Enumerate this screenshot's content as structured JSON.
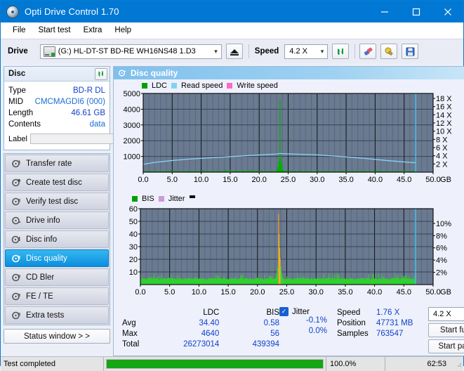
{
  "window": {
    "title": "Opti Drive Control 1.70",
    "icon": "disc-icon",
    "minimize": "minimize-icon",
    "maximize": "maximize-icon",
    "close": "close-icon"
  },
  "menu": [
    {
      "label": "File"
    },
    {
      "label": "Start test"
    },
    {
      "label": "Extra"
    },
    {
      "label": "Help"
    }
  ],
  "toolbar": {
    "drive_label": "Drive",
    "drive_value": "(G:)   HL-DT-ST BD-RE  WH16NS48 1.D3",
    "eject_icon": "eject-icon",
    "speed_label": "Speed",
    "speed_value": "4.2 X",
    "refresh_icon": "refresh-icon",
    "erase_icon": "eraser-icon",
    "bulb_icon": "bulb-icon",
    "save_icon": "save-icon"
  },
  "disc": {
    "header": "Disc",
    "refresh_icon": "refresh-icon",
    "fields": [
      {
        "key": "Type",
        "value": "BD-R DL",
        "link": false
      },
      {
        "key": "MID",
        "value": "CMCMAGDI6 (000)",
        "link": true
      },
      {
        "key": "Length",
        "value": "46.61 GB",
        "link": false
      },
      {
        "key": "Contents",
        "value": "data",
        "link": true
      }
    ],
    "label_key": "Label",
    "label_value": "",
    "label_placeholder": "",
    "disc_icon": "cd-icon"
  },
  "nav": {
    "items": [
      {
        "label": "Transfer rate",
        "icon": "transfer-icon",
        "active": false
      },
      {
        "label": "Create test disc",
        "icon": "create-disc-icon",
        "active": false
      },
      {
        "label": "Verify test disc",
        "icon": "verify-disc-icon",
        "active": false
      },
      {
        "label": "Drive info",
        "icon": "drive-info-icon",
        "active": false
      },
      {
        "label": "Disc info",
        "icon": "disc-info-icon",
        "active": false
      },
      {
        "label": "Disc quality",
        "icon": "disc-quality-icon",
        "active": true
      },
      {
        "label": "CD Bler",
        "icon": "cd-bler-icon",
        "active": false
      },
      {
        "label": "FE / TE",
        "icon": "fe-te-icon",
        "active": false
      },
      {
        "label": "Extra tests",
        "icon": "extra-tests-icon",
        "active": false
      }
    ],
    "status_window": "Status window > >"
  },
  "panel": {
    "title": "Disc quality",
    "icon": "disc-quality-icon"
  },
  "chart_data": [
    {
      "type": "area",
      "name": "ldc-chart",
      "title": "",
      "xlabel": "GB",
      "ylabel": "",
      "xlim": [
        0.0,
        50.0
      ],
      "ylim": [
        0,
        5000
      ],
      "y2lim": [
        0,
        18
      ],
      "grid": true,
      "legend": [
        {
          "label": "LDC",
          "color": "#00a000"
        },
        {
          "label": "Read speed",
          "color": "#80d8f0"
        },
        {
          "label": "Write speed",
          "color": "#ff66cc"
        }
      ],
      "xticks": [
        "0.0",
        "5.0",
        "10.0",
        "15.0",
        "20.0",
        "25.0",
        "30.0",
        "35.0",
        "40.0",
        "45.0",
        "50.0"
      ],
      "yticks": [
        "5000",
        "4000",
        "3000",
        "2000",
        "1000"
      ],
      "y2ticks": [
        "18 X",
        "16 X",
        "14 X",
        "12 X",
        "10 X",
        "8 X",
        "6 X",
        "4 X",
        "2 X"
      ],
      "series": [
        {
          "name": "LDC",
          "color": "#00b000",
          "kind": "bars",
          "x_end": 47.0,
          "baseline": 30,
          "spike": {
            "x": 23.6,
            "y": 4640
          },
          "noise_amp": 120
        },
        {
          "name": "Read speed",
          "color": "#8ad4f5",
          "kind": "line",
          "points": [
            [
              0.0,
              500
            ],
            [
              2.0,
              620
            ],
            [
              5.0,
              740
            ],
            [
              8.0,
              830
            ],
            [
              11.0,
              900
            ],
            [
              14.0,
              960
            ],
            [
              17.0,
              1030
            ],
            [
              20.0,
              1090
            ],
            [
              23.0,
              1150
            ],
            [
              23.6,
              1190
            ],
            [
              24.2,
              1170
            ],
            [
              26.0,
              1150
            ],
            [
              30.0,
              1100
            ],
            [
              34.0,
              1000
            ],
            [
              38.0,
              880
            ],
            [
              42.0,
              740
            ],
            [
              46.0,
              620
            ],
            [
              47.0,
              600
            ]
          ]
        },
        {
          "name": "Write speed",
          "color": "#ff66cc",
          "kind": "line",
          "points": []
        }
      ],
      "markers": [
        {
          "x": 47.0,
          "color": "#3bc8f5",
          "label": "position-marker"
        }
      ]
    },
    {
      "type": "area",
      "name": "bis-chart",
      "title": "",
      "xlabel": "GB",
      "ylabel": "",
      "xlim": [
        0.0,
        50.0
      ],
      "ylim": [
        0,
        60
      ],
      "y2lim": [
        0,
        10
      ],
      "grid": true,
      "legend": [
        {
          "label": "BIS",
          "color": "#00a000"
        },
        {
          "label": "Jitter",
          "color": "#cc9ad8"
        }
      ],
      "xticks": [
        "0.0",
        "5.0",
        "10.0",
        "15.0",
        "20.0",
        "25.0",
        "30.0",
        "35.0",
        "40.0",
        "45.0",
        "50.0"
      ],
      "yticks": [
        "60",
        "50",
        "40",
        "30",
        "20",
        "10"
      ],
      "y2ticks": [
        "10%",
        "8%",
        "6%",
        "4%",
        "2%"
      ],
      "series": [
        {
          "name": "BIS",
          "color": "#2fd02f",
          "kind": "bars",
          "x_end": 47.0,
          "baseline": 4,
          "spike": {
            "x": 23.6,
            "y": 56
          },
          "noise_amp": 4
        }
      ],
      "markers": [
        {
          "x": 47.0,
          "color": "#3bc8f5",
          "label": "position-marker"
        }
      ]
    }
  ],
  "stats": {
    "columns": [
      "LDC",
      "BIS"
    ],
    "rows": [
      {
        "key": "Avg",
        "ldc": "34.40",
        "bis": "0.58"
      },
      {
        "key": "Max",
        "ldc": "4640",
        "bis": "56"
      },
      {
        "key": "Total",
        "ldc": "26273014",
        "bis": "439394"
      }
    ],
    "jitter": {
      "label": "Jitter",
      "checked": true,
      "values": [
        "-0.1%",
        "0.0%"
      ]
    },
    "info": [
      {
        "key": "Speed",
        "value": "1.76 X"
      },
      {
        "key": "Position",
        "value": "47731 MB"
      },
      {
        "key": "Samples",
        "value": "763547"
      }
    ],
    "speed_select": "4.2 X",
    "start_full": "Start full",
    "start_part": "Start part"
  },
  "statusbar": {
    "message": "Test completed",
    "progress_percent": 100.0,
    "progress_text": "100.0%",
    "elapsed": "62:53"
  }
}
